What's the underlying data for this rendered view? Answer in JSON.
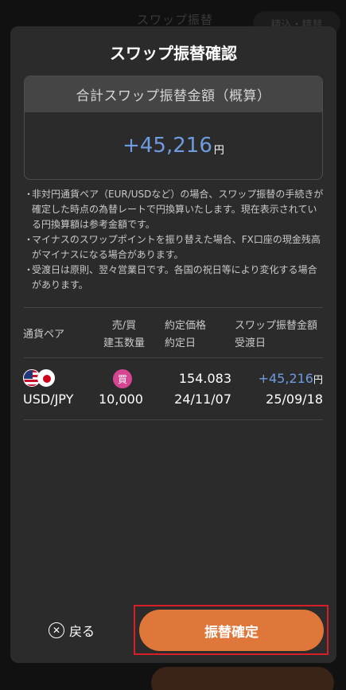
{
  "background": {
    "title": "スワップ振替",
    "pill": "精込・精替"
  },
  "dialog": {
    "title": "スワップ振替確認",
    "total": {
      "label": "合計スワップ振替金額（概算）",
      "value": "+45,216",
      "unit": "円"
    },
    "notes": [
      "非対円通貨ペア（EUR/USDなど）の場合、スワップ振替の手続きが確定した時点の為替レートで円換算いたします。現在表示されている円換算額は参考金額です。",
      "マイナスのスワップポイントを振り替えた場合、FX口座の現金残高がマイナスになる場合があります。",
      "受渡日は原則、翌々営業日です。各国の祝日等により変化する場合があります。"
    ],
    "note_bullet": "・",
    "table": {
      "headers": {
        "pair": "通貨ペア",
        "side_line1": "売/買",
        "side_line2": "建玉数量",
        "price_line1": "約定価格",
        "price_line2": "約定日",
        "swap_line1": "スワップ振替金額",
        "swap_line2": "受渡日"
      },
      "rows": [
        {
          "pair": "USD/JPY",
          "side": "買",
          "quantity": "10,000",
          "price": "154.083",
          "trade_date": "24/11/07",
          "swap_amount": "+45,216",
          "swap_unit": "円",
          "delivery_date": "25/09/18"
        }
      ]
    },
    "back_label": "戻る",
    "confirm_label": "振替確定"
  },
  "colors": {
    "accent_blue": "#6f9be0",
    "confirm_orange": "#e0773a",
    "buy_badge": "#d64591",
    "highlight_red": "#d91e2a"
  }
}
